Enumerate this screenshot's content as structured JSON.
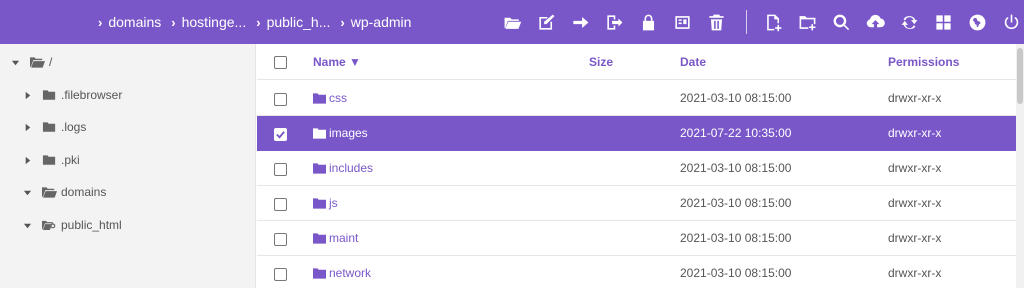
{
  "breadcrumb": [
    "domains",
    "hostinge...",
    "public_h...",
    "wp-admin"
  ],
  "toolbar": {
    "left": [
      "folder-open-icon",
      "edit-icon",
      "move-icon",
      "logout-icon",
      "lock-icon",
      "archive-icon",
      "trash-icon"
    ],
    "right": [
      "new-file-icon",
      "new-folder-icon",
      "search-icon",
      "upload-icon",
      "refresh-icon",
      "grid-view-icon",
      "globe-icon",
      "power-icon"
    ]
  },
  "sidebar": {
    "items": [
      {
        "label": "/",
        "expanded": true,
        "icon": "folder-open-icon"
      },
      {
        "label": ".filebrowser",
        "expanded": false,
        "icon": "folder-icon"
      },
      {
        "label": ".logs",
        "expanded": false,
        "icon": "folder-icon"
      },
      {
        "label": ".pki",
        "expanded": false,
        "icon": "folder-icon"
      },
      {
        "label": "domains",
        "expanded": true,
        "icon": "folder-open-icon"
      },
      {
        "label": "public_html",
        "expanded": true,
        "icon": "folder-link-icon"
      }
    ]
  },
  "table": {
    "columns": {
      "name": "Name ▼",
      "size": "Size",
      "date": "Date",
      "permissions": "Permissions"
    },
    "rows": [
      {
        "name": "css",
        "size": "",
        "date": "2021-03-10 08:15:00",
        "permissions": "drwxr-xr-x",
        "selected": false
      },
      {
        "name": "images",
        "size": "",
        "date": "2021-07-22 10:35:00",
        "permissions": "drwxr-xr-x",
        "selected": true
      },
      {
        "name": "includes",
        "size": "",
        "date": "2021-03-10 08:15:00",
        "permissions": "drwxr-xr-x",
        "selected": false
      },
      {
        "name": "js",
        "size": "",
        "date": "2021-03-10 08:15:00",
        "permissions": "drwxr-xr-x",
        "selected": false
      },
      {
        "name": "maint",
        "size": "",
        "date": "2021-03-10 08:15:00",
        "permissions": "drwxr-xr-x",
        "selected": false
      },
      {
        "name": "network",
        "size": "",
        "date": "2021-03-10 08:15:00",
        "permissions": "drwxr-xr-x",
        "selected": false
      }
    ]
  },
  "colors": {
    "accent": "#7a57c9",
    "sidebar_bg": "#f3f3f3"
  }
}
